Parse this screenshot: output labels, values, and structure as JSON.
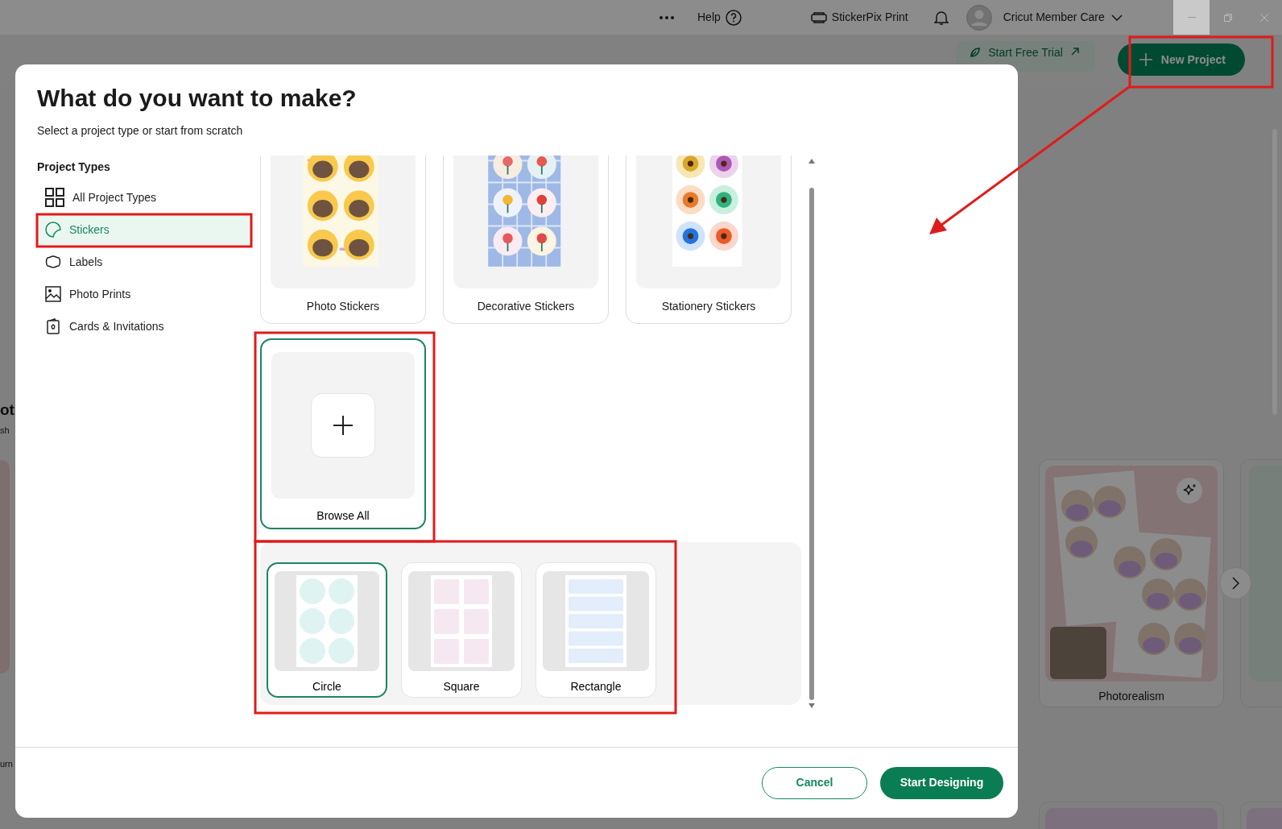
{
  "app_bar": {
    "help": "Help",
    "machine": "StickerPix Print",
    "account": "Cricut Member Care"
  },
  "toolbar": {
    "trial_button": "Start Free Trial",
    "new_project_button": "New Project"
  },
  "background": {
    "fragments": [
      "ot",
      "sh",
      "urn"
    ],
    "cards": [
      {
        "label": "Photorealism"
      }
    ]
  },
  "dialog": {
    "title": "What do you want to make?",
    "subtitle": "Select a project type or start from scratch",
    "sidebar": {
      "heading": "Project Types",
      "items": [
        {
          "label": "All Project Types",
          "selected": false
        },
        {
          "label": "Stickers",
          "selected": true
        },
        {
          "label": "Labels",
          "selected": false
        },
        {
          "label": "Photo Prints",
          "selected": false
        },
        {
          "label": "Cards & Invitations",
          "selected": false
        }
      ]
    },
    "project_cards": [
      {
        "label": "Photo Stickers",
        "kind": "picture"
      },
      {
        "label": "Decorative Stickers",
        "kind": "picture"
      },
      {
        "label": "Stationery Stickers",
        "kind": "picture"
      }
    ],
    "browse_card": {
      "label": "Browse All",
      "selected": true
    },
    "shapes": [
      {
        "label": "Circle",
        "kind": "circle",
        "selected": true
      },
      {
        "label": "Square",
        "kind": "square",
        "selected": false
      },
      {
        "label": "Rectangle",
        "kind": "rectangle",
        "selected": false
      }
    ],
    "buttons": {
      "cancel": "Cancel",
      "start": "Start Designing"
    }
  }
}
